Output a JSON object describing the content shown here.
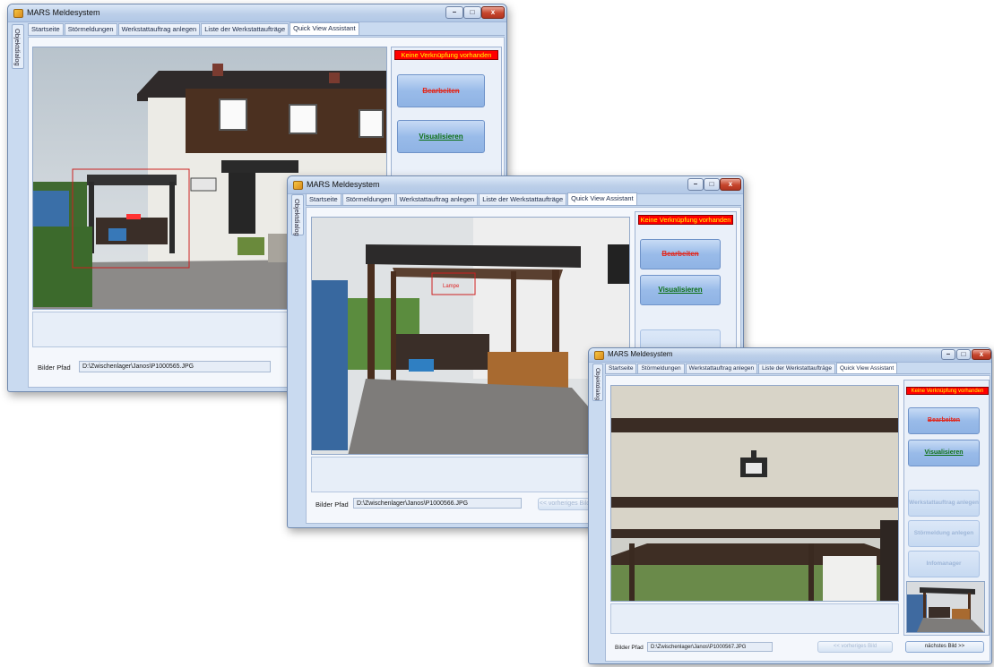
{
  "window_title": "MARS Meldesystem",
  "side_tab": "Objektdialog",
  "tabs": [
    "Startseite",
    "Störmeldungen",
    "Werkstattauftrag anlegen",
    "Liste der Werkstattaufträge",
    "Quick View Assistant"
  ],
  "active_tab": "Quick View Assistant",
  "link_status": "Keine Verknüpfung vorhanden",
  "buttons": {
    "edit": "Bearbeiten",
    "visualize": "Visualisieren",
    "create_work_order": "Werkstattauftrag anlegen",
    "create_fault_report": "Störmeldung anlegen",
    "info_manager": "Infomanager",
    "prev_image": "<< vorheriges Bild",
    "next_image": "nächstes Bild >>"
  },
  "path_label": "Bilder Pfad",
  "hotspot_label": "Lampe",
  "windows": [
    {
      "image_path": "D:\\Zwischenlager\\Janos\\P1000565.JPG"
    },
    {
      "image_path": "D:\\Zwischenlager\\Janos\\P1000566.JPG"
    },
    {
      "image_path": "D:\\Zwischenlager\\Janos\\P1000567.JPG"
    }
  ],
  "window_controls": {
    "minimize": "–",
    "maximize": "□",
    "close": "x"
  },
  "colors": {
    "status_bg": "#ff0000",
    "status_text": "#ffff00",
    "edit_text": "#e02a20",
    "visualize_text": "#0a6e10"
  }
}
